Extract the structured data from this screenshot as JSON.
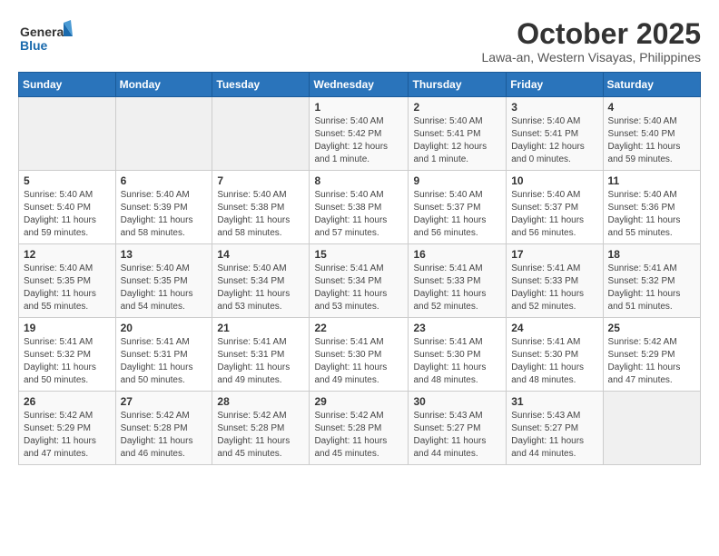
{
  "header": {
    "logo_general": "General",
    "logo_blue": "Blue",
    "month_title": "October 2025",
    "location": "Lawa-an, Western Visayas, Philippines"
  },
  "days_of_week": [
    "Sunday",
    "Monday",
    "Tuesday",
    "Wednesday",
    "Thursday",
    "Friday",
    "Saturday"
  ],
  "weeks": [
    [
      {
        "day": "",
        "sunrise": "",
        "sunset": "",
        "daylight": ""
      },
      {
        "day": "",
        "sunrise": "",
        "sunset": "",
        "daylight": ""
      },
      {
        "day": "",
        "sunrise": "",
        "sunset": "",
        "daylight": ""
      },
      {
        "day": "1",
        "sunrise": "Sunrise: 5:40 AM",
        "sunset": "Sunset: 5:42 PM",
        "daylight": "Daylight: 12 hours and 1 minute."
      },
      {
        "day": "2",
        "sunrise": "Sunrise: 5:40 AM",
        "sunset": "Sunset: 5:41 PM",
        "daylight": "Daylight: 12 hours and 1 minute."
      },
      {
        "day": "3",
        "sunrise": "Sunrise: 5:40 AM",
        "sunset": "Sunset: 5:41 PM",
        "daylight": "Daylight: 12 hours and 0 minutes."
      },
      {
        "day": "4",
        "sunrise": "Sunrise: 5:40 AM",
        "sunset": "Sunset: 5:40 PM",
        "daylight": "Daylight: 11 hours and 59 minutes."
      }
    ],
    [
      {
        "day": "5",
        "sunrise": "Sunrise: 5:40 AM",
        "sunset": "Sunset: 5:40 PM",
        "daylight": "Daylight: 11 hours and 59 minutes."
      },
      {
        "day": "6",
        "sunrise": "Sunrise: 5:40 AM",
        "sunset": "Sunset: 5:39 PM",
        "daylight": "Daylight: 11 hours and 58 minutes."
      },
      {
        "day": "7",
        "sunrise": "Sunrise: 5:40 AM",
        "sunset": "Sunset: 5:38 PM",
        "daylight": "Daylight: 11 hours and 58 minutes."
      },
      {
        "day": "8",
        "sunrise": "Sunrise: 5:40 AM",
        "sunset": "Sunset: 5:38 PM",
        "daylight": "Daylight: 11 hours and 57 minutes."
      },
      {
        "day": "9",
        "sunrise": "Sunrise: 5:40 AM",
        "sunset": "Sunset: 5:37 PM",
        "daylight": "Daylight: 11 hours and 56 minutes."
      },
      {
        "day": "10",
        "sunrise": "Sunrise: 5:40 AM",
        "sunset": "Sunset: 5:37 PM",
        "daylight": "Daylight: 11 hours and 56 minutes."
      },
      {
        "day": "11",
        "sunrise": "Sunrise: 5:40 AM",
        "sunset": "Sunset: 5:36 PM",
        "daylight": "Daylight: 11 hours and 55 minutes."
      }
    ],
    [
      {
        "day": "12",
        "sunrise": "Sunrise: 5:40 AM",
        "sunset": "Sunset: 5:35 PM",
        "daylight": "Daylight: 11 hours and 55 minutes."
      },
      {
        "day": "13",
        "sunrise": "Sunrise: 5:40 AM",
        "sunset": "Sunset: 5:35 PM",
        "daylight": "Daylight: 11 hours and 54 minutes."
      },
      {
        "day": "14",
        "sunrise": "Sunrise: 5:40 AM",
        "sunset": "Sunset: 5:34 PM",
        "daylight": "Daylight: 11 hours and 53 minutes."
      },
      {
        "day": "15",
        "sunrise": "Sunrise: 5:41 AM",
        "sunset": "Sunset: 5:34 PM",
        "daylight": "Daylight: 11 hours and 53 minutes."
      },
      {
        "day": "16",
        "sunrise": "Sunrise: 5:41 AM",
        "sunset": "Sunset: 5:33 PM",
        "daylight": "Daylight: 11 hours and 52 minutes."
      },
      {
        "day": "17",
        "sunrise": "Sunrise: 5:41 AM",
        "sunset": "Sunset: 5:33 PM",
        "daylight": "Daylight: 11 hours and 52 minutes."
      },
      {
        "day": "18",
        "sunrise": "Sunrise: 5:41 AM",
        "sunset": "Sunset: 5:32 PM",
        "daylight": "Daylight: 11 hours and 51 minutes."
      }
    ],
    [
      {
        "day": "19",
        "sunrise": "Sunrise: 5:41 AM",
        "sunset": "Sunset: 5:32 PM",
        "daylight": "Daylight: 11 hours and 50 minutes."
      },
      {
        "day": "20",
        "sunrise": "Sunrise: 5:41 AM",
        "sunset": "Sunset: 5:31 PM",
        "daylight": "Daylight: 11 hours and 50 minutes."
      },
      {
        "day": "21",
        "sunrise": "Sunrise: 5:41 AM",
        "sunset": "Sunset: 5:31 PM",
        "daylight": "Daylight: 11 hours and 49 minutes."
      },
      {
        "day": "22",
        "sunrise": "Sunrise: 5:41 AM",
        "sunset": "Sunset: 5:30 PM",
        "daylight": "Daylight: 11 hours and 49 minutes."
      },
      {
        "day": "23",
        "sunrise": "Sunrise: 5:41 AM",
        "sunset": "Sunset: 5:30 PM",
        "daylight": "Daylight: 11 hours and 48 minutes."
      },
      {
        "day": "24",
        "sunrise": "Sunrise: 5:41 AM",
        "sunset": "Sunset: 5:30 PM",
        "daylight": "Daylight: 11 hours and 48 minutes."
      },
      {
        "day": "25",
        "sunrise": "Sunrise: 5:42 AM",
        "sunset": "Sunset: 5:29 PM",
        "daylight": "Daylight: 11 hours and 47 minutes."
      }
    ],
    [
      {
        "day": "26",
        "sunrise": "Sunrise: 5:42 AM",
        "sunset": "Sunset: 5:29 PM",
        "daylight": "Daylight: 11 hours and 47 minutes."
      },
      {
        "day": "27",
        "sunrise": "Sunrise: 5:42 AM",
        "sunset": "Sunset: 5:28 PM",
        "daylight": "Daylight: 11 hours and 46 minutes."
      },
      {
        "day": "28",
        "sunrise": "Sunrise: 5:42 AM",
        "sunset": "Sunset: 5:28 PM",
        "daylight": "Daylight: 11 hours and 45 minutes."
      },
      {
        "day": "29",
        "sunrise": "Sunrise: 5:42 AM",
        "sunset": "Sunset: 5:28 PM",
        "daylight": "Daylight: 11 hours and 45 minutes."
      },
      {
        "day": "30",
        "sunrise": "Sunrise: 5:43 AM",
        "sunset": "Sunset: 5:27 PM",
        "daylight": "Daylight: 11 hours and 44 minutes."
      },
      {
        "day": "31",
        "sunrise": "Sunrise: 5:43 AM",
        "sunset": "Sunset: 5:27 PM",
        "daylight": "Daylight: 11 hours and 44 minutes."
      },
      {
        "day": "",
        "sunrise": "",
        "sunset": "",
        "daylight": ""
      }
    ]
  ]
}
